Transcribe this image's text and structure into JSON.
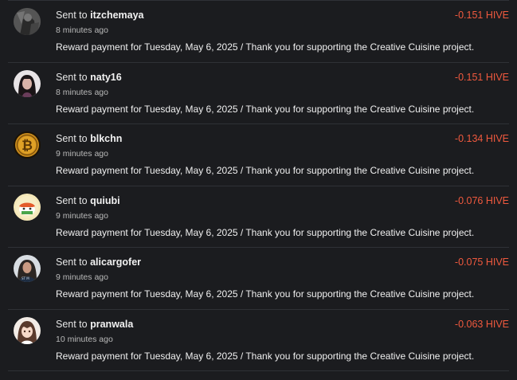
{
  "sent_prefix": "Sent to",
  "transactions": [
    {
      "user": "itzchemaya",
      "time": "8 minutes ago",
      "amount": "-0.151 HIVE",
      "memo": "Reward payment for Tuesday, May 6, 2025 / Thank you for supporting the Creative Cuisine project.",
      "avatar": "person-photo-icon"
    },
    {
      "user": "naty16",
      "time": "8 minutes ago",
      "amount": "-0.151 HIVE",
      "memo": "Reward payment for Tuesday, May 6, 2025 / Thank you for supporting the Creative Cuisine project.",
      "avatar": "woman-photo-icon"
    },
    {
      "user": "blkchn",
      "time": "9 minutes ago",
      "amount": "-0.134 HIVE",
      "memo": "Reward payment for Tuesday, May 6, 2025 / Thank you for supporting the Creative Cuisine project.",
      "avatar": "bitcoin-coin-icon"
    },
    {
      "user": "quiubi",
      "time": "9 minutes ago",
      "amount": "-0.076 HIVE",
      "memo": "Reward payment for Tuesday, May 6, 2025 / Thank you for supporting the Creative Cuisine project.",
      "avatar": "cartoon-avatar-icon"
    },
    {
      "user": "alicargofer",
      "time": "9 minutes ago",
      "amount": "-0.075 HIVE",
      "memo": "Reward payment for Tuesday, May 6, 2025 / Thank you for supporting the Creative Cuisine project.",
      "avatar": "woman-portrait-icon"
    },
    {
      "user": "pranwala",
      "time": "10 minutes ago",
      "amount": "-0.063 HIVE",
      "memo": "Reward payment for Tuesday, May 6, 2025 / Thank you for supporting the Creative Cuisine project.",
      "avatar": "anime-girl-icon"
    }
  ],
  "colors": {
    "background": "#1b1c1f",
    "amount_negative": "#f0593e",
    "divider": "#2f3136"
  }
}
